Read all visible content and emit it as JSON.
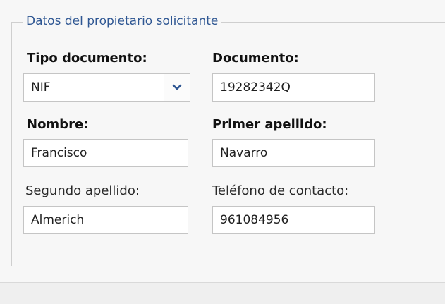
{
  "form": {
    "legend": "Datos del propietario solicitante",
    "fields": {
      "tipo_documento": {
        "label": "Tipo documento:",
        "value": "NIF",
        "options": [
          "NIF"
        ]
      },
      "documento": {
        "label": "Documento:",
        "value": "19282342Q"
      },
      "nombre": {
        "label": "Nombre:",
        "value": "Francisco"
      },
      "primer_apellido": {
        "label": "Primer apellido:",
        "value": "Navarro"
      },
      "segundo_apellido": {
        "label": "Segundo apellido:",
        "value": "Almerich"
      },
      "telefono": {
        "label": "Teléfono de contacto:",
        "value": "961084956"
      }
    }
  },
  "icons": {
    "select_arrow": "chevron-down-icon"
  },
  "colors": {
    "legend_text": "#2f5793",
    "arrow": "#2f5793",
    "field_border": "#c5c5c5",
    "panel_background": "#f7f7f7"
  }
}
